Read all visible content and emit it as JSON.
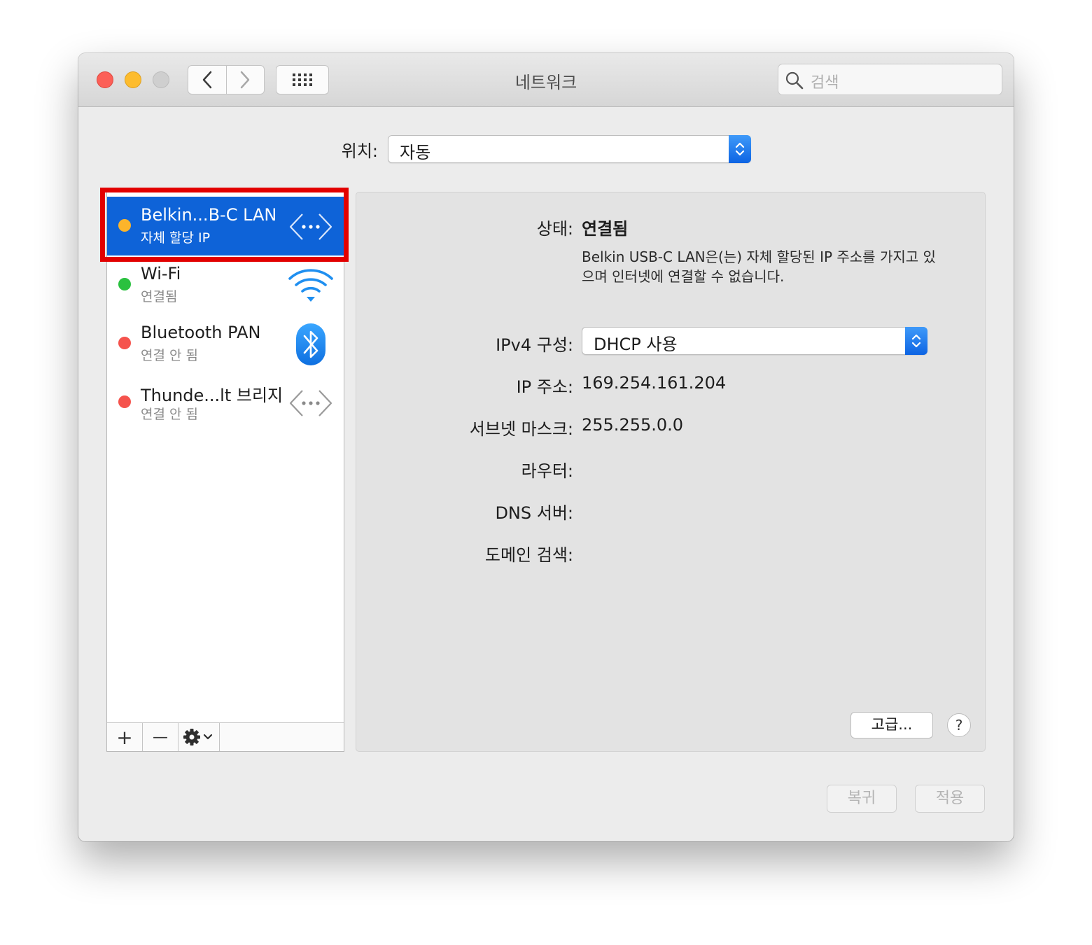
{
  "window": {
    "title": "네트워크"
  },
  "search": {
    "placeholder": "검색"
  },
  "location": {
    "label": "위치:",
    "value": "자동"
  },
  "services": [
    {
      "name": "Belkin...B-C LAN",
      "status": "자체 할당 IP",
      "dot_color": "#fcb42b",
      "icon": "ethernet-icon",
      "selected": true
    },
    {
      "name": "Wi-Fi",
      "status": "연결됨",
      "dot_color": "#2ac13f",
      "icon": "wifi-icon",
      "selected": false
    },
    {
      "name": "Bluetooth PAN",
      "status": "연결 안 됨",
      "dot_color": "#f5534d",
      "icon": "bluetooth-icon",
      "selected": false
    },
    {
      "name": "Thunde...lt 브리지",
      "status": "연결 안 됨",
      "dot_color": "#f5534d",
      "icon": "ethernet-icon",
      "selected": false
    }
  ],
  "sidebar_toolbar": {
    "add": "+",
    "remove": "—"
  },
  "detail": {
    "status_label": "상태:",
    "status_value": "연결됨",
    "status_description": "Belkin USB-C LAN은(는) 자체 할당된 IP 주소를 가지고 있으며 인터넷에 연결할 수 없습니다.",
    "ipv4_label": "IPv4 구성:",
    "ipv4_value": "DHCP 사용",
    "ip_label": "IP 주소:",
    "ip_value": "169.254.161.204",
    "subnet_label": "서브넷 마스크:",
    "subnet_value": "255.255.0.0",
    "router_label": "라우터:",
    "dns_label": "DNS 서버:",
    "domain_label": "도메인 검색:",
    "advanced_button": "고급...",
    "help_button": "?"
  },
  "footer": {
    "revert_button": "복귀",
    "apply_button": "적용"
  },
  "colors": {
    "accent": "#0e63d8",
    "highlight_box": "#e20000"
  }
}
